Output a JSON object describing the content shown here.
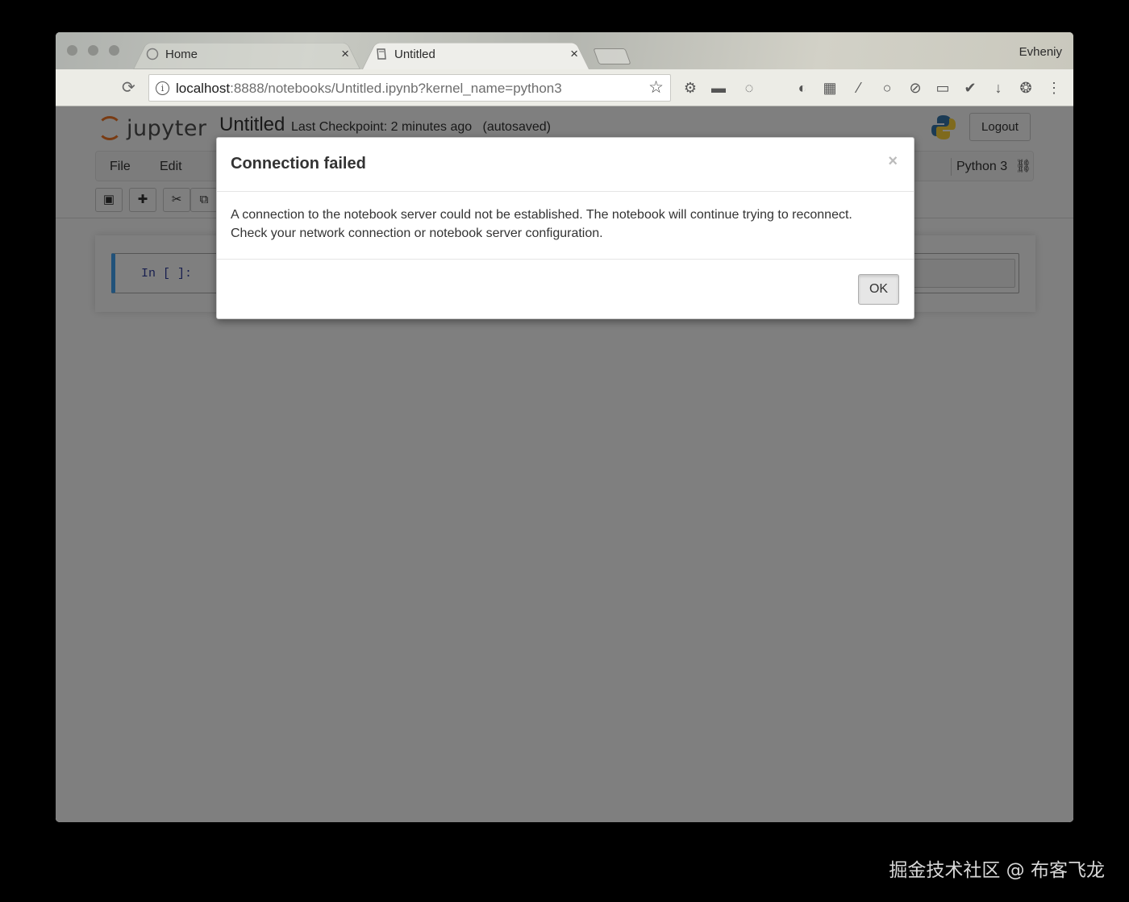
{
  "browser": {
    "user_name": "Evheniy",
    "tabs": [
      {
        "label": "Home",
        "active": false
      },
      {
        "label": "Untitled",
        "active": true
      }
    ],
    "url": {
      "host": "localhost",
      "rest": ":8888/notebooks/Untitled.ipynb?kernel_name=python3"
    }
  },
  "jupyter": {
    "logo_text": "jupyter",
    "notebook_name": "Untitled",
    "checkpoint_text": "Last Checkpoint: 2 minutes ago",
    "autosave_text": "(autosaved)",
    "logout_label": "Logout",
    "menu": {
      "file": "File",
      "edit": "Edit"
    },
    "kernel_name": "Python 3",
    "cell_prompt": "In [ ]:"
  },
  "dialog": {
    "title": "Connection failed",
    "close_glyph": "×",
    "message_line1": "A connection to the notebook server could not be established. The notebook will continue trying to reconnect.",
    "message_line2": "Check your network connection or notebook server configuration.",
    "ok_label": "OK"
  },
  "watermark": "掘金技术社区 @ 布客飞龙",
  "colors": {
    "jupyter_orange": "#f37726",
    "backdrop": "#7a7a7a",
    "cell_selected": "#42a5f5"
  }
}
